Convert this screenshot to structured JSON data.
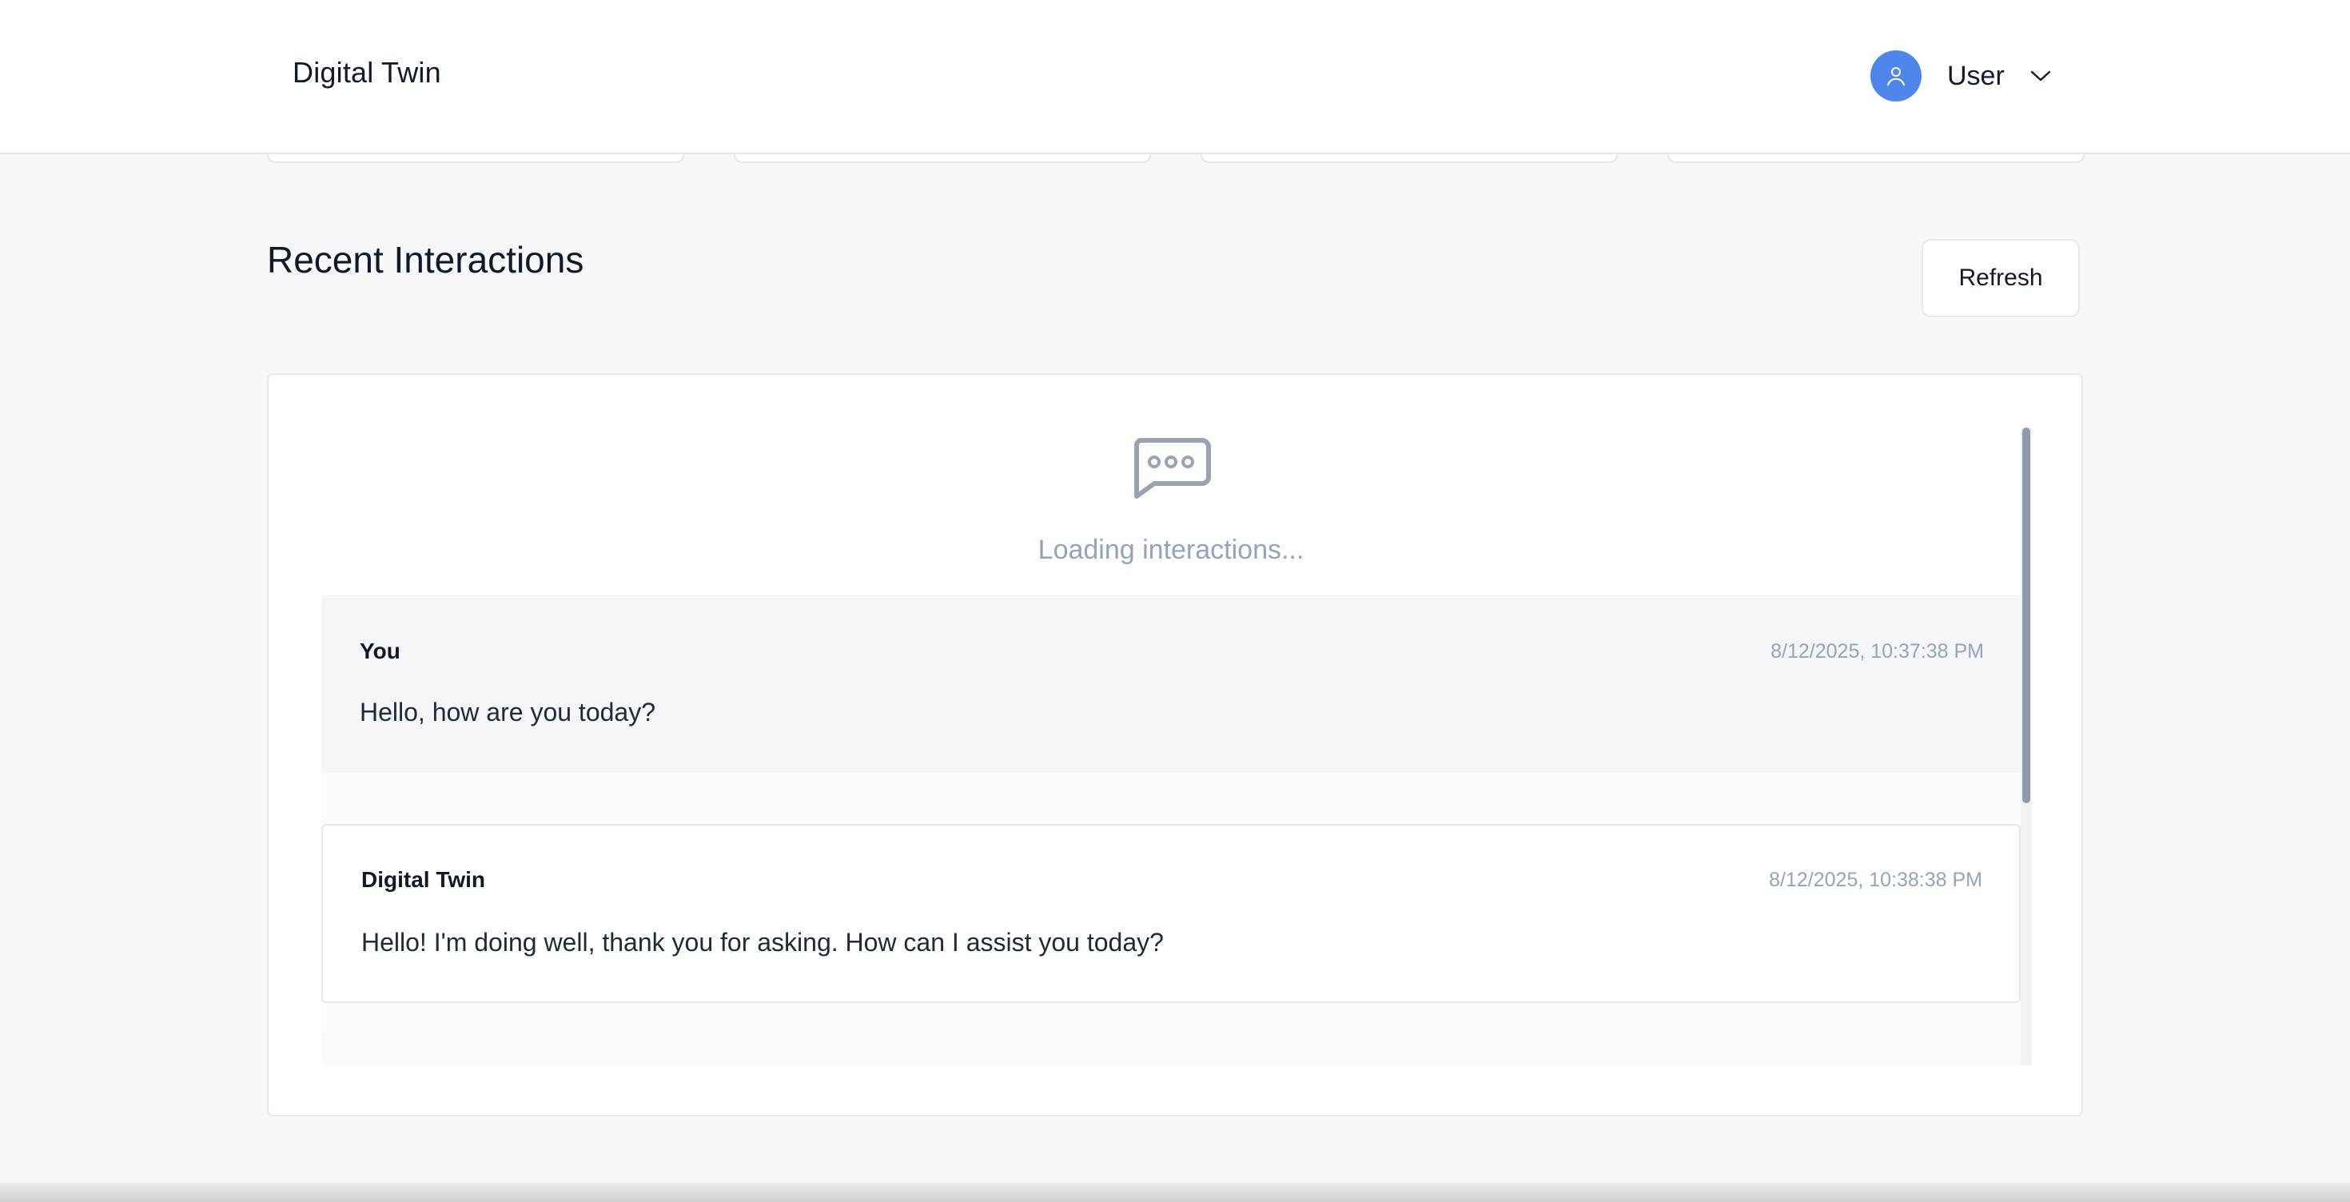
{
  "header": {
    "brand": "Digital Twin",
    "user": {
      "name": "User",
      "avatar_icon": "user-icon",
      "menu_icon": "chevron-down-icon"
    }
  },
  "section": {
    "title": "Recent Interactions",
    "refresh_label": "Refresh"
  },
  "loading": {
    "icon": "chat-bubble-icon",
    "text": "Loading interactions..."
  },
  "messages": [
    {
      "author": "You",
      "time": "8/12/2025, 10:37:38 PM",
      "text": "Hello, how are you today?"
    },
    {
      "author": "Digital Twin",
      "time": "8/12/2025, 10:38:38 PM",
      "text": "Hello! I'm doing well, thank you for asking. How can I assist you today?"
    }
  ],
  "colors": {
    "accent": "#4f86ec",
    "muted_text": "#94a3b8",
    "background": "#f7f8fa"
  }
}
